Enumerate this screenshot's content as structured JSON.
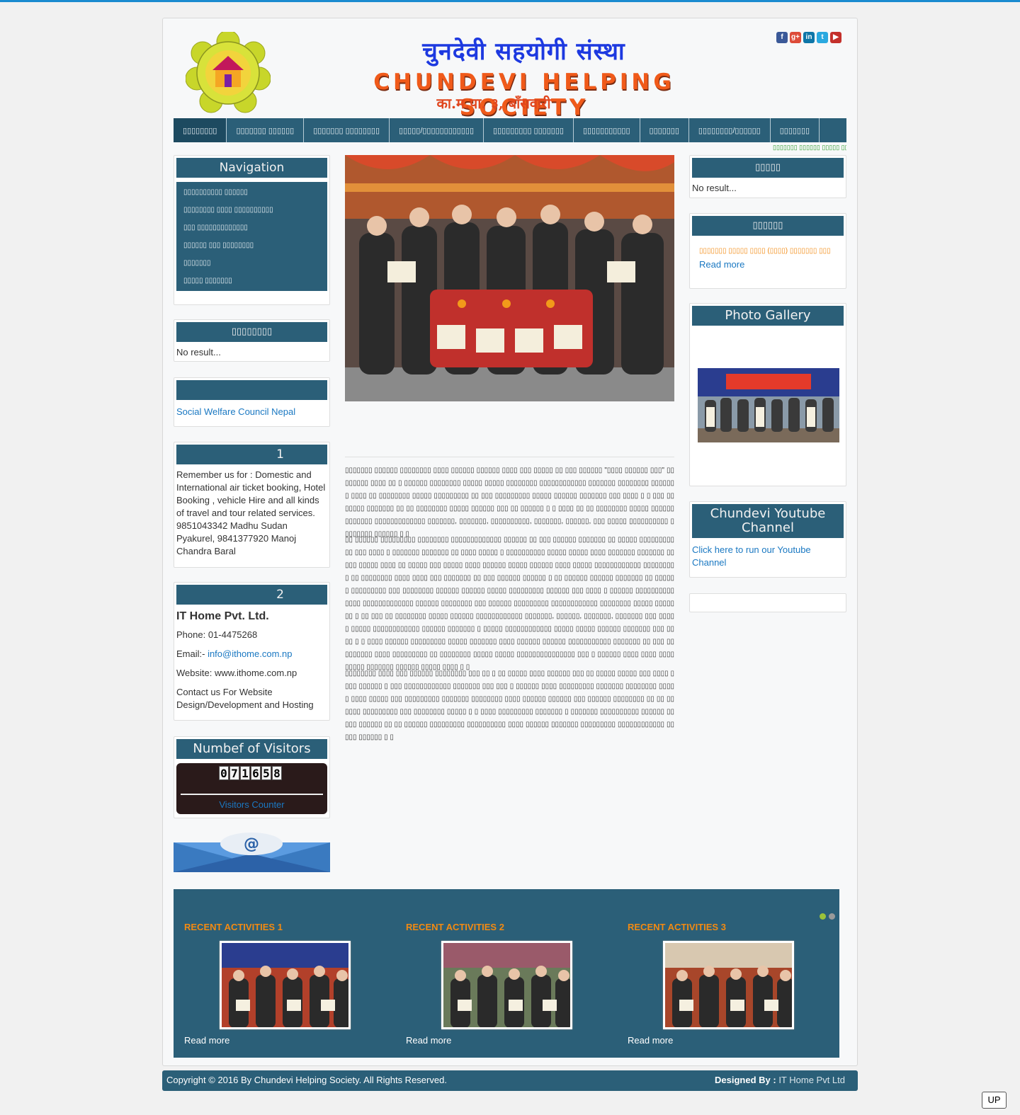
{
  "header": {
    "title_np": "चुनदेवी सहयोगी संस्था",
    "title_en": "CHUNDEVI HELPING SOCIETY",
    "address": "का.म.पा. ३, बाँसवारी",
    "socials": [
      {
        "icon": "facebook-icon",
        "glyph": "f",
        "color": "#3b5998"
      },
      {
        "icon": "google-plus-icon",
        "glyph": "g+",
        "color": "#dd4b39"
      },
      {
        "icon": "linkedin-icon",
        "glyph": "in",
        "color": "#0e76a8"
      },
      {
        "icon": "twitter-icon",
        "glyph": "t",
        "color": "#2aa9e0"
      },
      {
        "icon": "youtube-icon",
        "glyph": "▶",
        "color": "#c4302b"
      }
    ]
  },
  "menu": [
    "▯▯▯▯▯▯▯▯",
    "▯▯▯▯▯▯▯ ▯▯▯▯▯▯",
    "▯▯▯▯▯▯▯ ▯▯▯▯▯▯▯▯",
    "▯▯▯▯▯/▯▯▯▯▯▯▯▯▯▯▯▯",
    "▯▯▯▯▯▯▯▯▯ ▯▯▯▯▯▯▯",
    "▯▯▯▯▯▯▯▯▯▯▯",
    "▯▯▯▯▯▯▯",
    "▯▯▯▯▯▯▯▯/▯▯▯▯▯▯",
    "▯▯▯▯▯▯▯"
  ],
  "marquee": "▯▯▯▯▯▯▯ ▯▯▯▯▯▯ ▯▯▯▯▯ ▯▯▯",
  "left": {
    "navigation": {
      "title": "Navigation",
      "items": [
        "▯▯▯▯▯▯▯▯▯▯ ▯▯▯▯▯▯",
        "▯▯▯▯▯▯▯▯ ▯▯▯▯ ▯▯▯▯▯▯▯▯▯▯",
        "▯▯▯ ▯▯▯▯▯▯▯▯▯▯▯▯▯",
        "▯▯▯▯▯▯ ▯▯▯ ▯▯▯▯▯▯▯▯",
        "▯▯▯▯▯▯▯",
        "▯▯▯▯▯ ▯▯▯▯▯▯▯"
      ]
    },
    "box2": {
      "title": "▯▯▯▯▯▯▯▯",
      "text": "No result..."
    },
    "box3": {
      "title": "",
      "link": "Social Welfare Council Nepal"
    },
    "box4": {
      "title": "1",
      "text": "Remember us for : Domestic and International air ticket booking, Hotel Booking , vehicle Hire and all kinds of travel and tour related services. 9851043342 Madhu Sudan Pyakurel, 9841377920 Manoj Chandra Baral"
    },
    "box5": {
      "title": "2",
      "company": "IT Home Pvt. Ltd.",
      "phone": "Phone: 01-4475268",
      "email_label": "Email:- ",
      "email": "info@ithome.com.np",
      "website": "Website: www.ithome.com.np",
      "contact": "Contact us For Website Design/Development and Hosting"
    },
    "visitors": {
      "title": "Numbef of Visitors",
      "digits": [
        "0",
        "7",
        "1",
        "6",
        "5",
        "8"
      ],
      "label": "Visitors Counter"
    }
  },
  "right": {
    "box1": {
      "title": "▯▯▯▯▯",
      "text": "No result..."
    },
    "box2": {
      "title": "▯▯▯▯▯▯",
      "item": "▯▯▯▯▯▯▯ ▯▯▯▯▯ ▯▯▯▯ (▯▯▯▯) ▯▯▯▯▯▯▯ ▯▯▯",
      "more": "Read more"
    },
    "gallery": {
      "title": "Photo Gallery"
    },
    "youtube": {
      "title": "Chundevi Youtube Channel",
      "link": "Click here to run our Youtube Channel"
    }
  },
  "main": {
    "paragraphs": [
      "▯▯▯▯▯▯▯ ▯▯▯▯▯▯ ▯▯▯▯▯▯▯▯ ▯▯▯▯ ▯▯▯▯▯▯ ▯▯▯▯▯▯ ▯▯▯▯ ▯▯▯ ▯▯▯▯▯ ▯▯ ▯▯▯ ▯▯▯▯▯▯ \"▯▯▯▯ ▯▯▯▯▯▯ ▯▯▯\" ▯▯ ▯▯▯▯▯▯ ▯▯▯▯ ▯▯ ▯ ▯▯▯▯▯▯ ▯▯▯▯▯▯▯▯ ▯▯▯▯▯ ▯▯▯▯▯ ▯▯▯▯▯▯▯▯ ▯▯▯▯▯▯▯▯▯▯▯▯ ▯▯▯▯▯▯▯ ▯▯▯▯▯▯▯▯ ▯▯▯▯▯▯▯ ▯▯▯▯ ▯▯ ▯▯▯▯▯▯▯▯ ▯▯▯▯▯ ▯▯▯▯▯▯▯▯▯ ▯▯ ▯▯▯ ▯▯▯▯▯▯▯▯▯ ▯▯▯▯▯ ▯▯▯▯▯▯ ▯▯▯▯▯▯▯ ▯▯▯ ▯▯▯▯ ▯ ▯ ▯▯▯ ▯▯▯▯▯▯▯ ▯▯▯▯▯▯▯ ▯▯ ▯▯ ▯▯▯▯▯▯▯▯ ▯▯▯▯▯ ▯▯▯▯▯▯ ▯▯▯ ▯▯ ▯▯▯▯▯▯ ▯ ▯ ▯▯▯▯ ▯▯ ▯▯ ▯▯▯▯▯▯▯▯ ▯▯▯▯▯ ▯▯▯▯▯▯▯▯▯▯▯▯▯ ▯▯▯▯▯▯▯▯▯▯▯▯▯ ▯▯▯▯▯▯▯, ▯▯▯▯▯▯▯, ▯▯▯▯▯▯▯▯▯▯, ▯▯▯▯▯▯▯, ▯▯▯▯▯▯, ▯▯▯ ▯▯▯▯▯ ▯▯▯▯▯▯▯▯▯▯ ▯▯▯▯▯▯▯▯ ▯▯▯▯▯▯ ▯ ▯",
      "▯▯ ▯▯▯▯▯▯ ▯▯▯▯▯▯▯▯▯ ▯▯▯▯▯▯▯▯ ▯▯▯▯▯▯▯▯▯▯▯▯▯ ▯▯▯▯▯▯ ▯▯ ▯▯▯ ▯▯▯▯▯▯ ▯▯▯▯▯▯▯ ▯▯ ▯▯▯▯▯ ▯▯▯▯▯▯▯▯▯▯▯ ▯▯▯ ▯▯▯▯ ▯ ▯▯▯▯▯▯▯ ▯▯▯▯▯▯▯ ▯▯ ▯▯▯▯ ▯▯▯▯▯ ▯ ▯▯▯▯▯▯▯▯▯▯ ▯▯▯▯▯ ▯▯▯▯▯ ▯▯▯▯ ▯▯▯▯▯▯▯ ▯▯▯▯▯▯▯ ▯▯ ▯▯▯ ▯▯▯▯▯  ▯▯▯▯ ▯▯ ▯▯▯▯▯ ▯▯▯ ▯▯▯▯▯ ▯▯▯▯ ▯▯▯▯▯▯ ▯▯▯▯▯ ▯▯▯▯▯▯ ▯▯▯▯ ▯▯▯▯▯ ▯▯▯▯▯▯▯▯▯▯▯▯ ▯▯▯▯▯▯▯▯▯ ▯▯ ▯▯▯▯▯▯▯▯ ▯▯▯▯ ▯▯▯▯ ▯▯▯ ▯▯▯▯▯▯▯ ▯▯ ▯▯▯ ▯▯▯▯▯▯ ▯▯▯▯▯▯ ▯ ▯▯ ▯▯▯▯▯▯ ▯▯▯▯▯▯ ▯▯▯▯▯▯▯ ▯▯ ▯▯▯▯▯▯ ▯▯▯▯▯▯▯▯▯ ▯▯▯ ▯▯▯▯▯▯▯▯ ▯▯▯▯▯▯ ▯▯▯▯▯▯ ▯▯▯▯▯ ▯▯▯▯▯▯▯▯▯ ▯▯▯▯▯▯ ▯▯▯ ▯▯▯▯ ▯ ▯▯▯▯▯▯ ▯▯▯▯▯▯▯▯▯▯▯▯▯▯ ▯▯▯▯▯▯▯▯▯▯▯▯▯ ▯▯▯▯▯▯ ▯▯▯▯▯▯▯▯ ▯▯▯ ▯▯▯▯▯▯ ▯▯▯▯▯▯▯▯▯ ▯▯▯▯▯▯▯▯▯▯▯▯ ▯▯▯▯▯▯▯▯ ▯▯▯▯▯ ▯▯▯▯▯▯▯ ▯ ▯▯ ▯▯▯ ▯▯ ▯▯▯▯▯▯▯▯ ▯▯▯▯▯ ▯▯▯▯▯▯ ▯▯▯▯▯▯▯▯▯▯▯▯ ▯▯▯▯▯▯▯, ▯▯▯▯▯▯, ▯▯▯▯▯▯▯, ▯▯▯▯▯▯▯ ▯▯▯ ▯▯▯▯▯ ▯▯▯▯▯ ▯▯▯▯▯▯▯▯▯▯▯▯ ▯▯▯▯▯▯ ▯▯▯▯▯▯▯ ▯ ▯▯▯▯▯ ▯▯▯▯▯▯▯▯▯▯▯▯ ▯▯▯▯▯ ▯▯▯▯▯ ▯▯▯▯▯▯ ▯▯▯▯▯▯▯ ▯▯▯ ▯▯▯▯ ▯ ▯ ▯▯▯▯ ▯▯▯▯▯▯ ▯▯▯▯▯▯▯▯▯ ▯▯▯▯▯ ▯▯▯▯▯▯▯ ▯▯▯▯ ▯▯▯▯▯▯ ▯▯▯▯▯▯ ▯▯▯▯▯▯▯▯▯▯▯ ▯▯▯▯▯▯▯ ▯▯ ▯▯▯ ▯▯▯▯▯▯▯▯▯ ▯▯▯▯ ▯▯▯▯▯▯▯▯▯ ▯▯ ▯▯▯▯▯▯▯▯ ▯▯▯▯▯ ▯▯▯▯▯ ▯▯▯▯▯▯▯▯▯▯▯▯▯▯▯ ▯▯▯ ▯ ▯▯▯▯▯▯ ▯▯▯▯ ▯▯▯▯ ▯▯▯▯ ▯▯▯▯▯ ▯▯▯▯▯▯▯ ▯▯▯▯▯▯ ▯▯▯▯▯ ▯▯▯▯ ▯ ▯",
      "▯▯▯▯▯▯▯▯ ▯▯▯▯ ▯▯▯ ▯▯▯▯▯▯ ▯▯▯▯▯▯▯▯ ▯▯▯ ▯▯ ▯ ▯▯ ▯▯▯▯▯ ▯▯▯▯ ▯▯▯▯▯▯ ▯▯▯ ▯▯ ▯▯▯▯▯ ▯▯▯▯▯ ▯▯▯ ▯▯▯▯ ▯▯▯▯ ▯▯▯▯▯▯ ▯ ▯▯▯ ▯▯▯▯▯▯▯▯▯▯▯▯ ▯▯▯▯▯▯▯ ▯▯▯ ▯▯▯ ▯ ▯▯▯▯▯▯ ▯▯▯▯ ▯▯▯▯▯▯▯▯▯ ▯▯▯▯▯▯▯ ▯▯▯▯▯▯▯▯ ▯▯▯▯▯ ▯▯▯▯ ▯▯▯▯▯ ▯▯▯ ▯▯▯▯▯▯▯▯▯ ▯▯▯▯▯▯▯ ▯▯▯▯▯▯▯▯ ▯▯▯▯ ▯▯▯▯▯▯ ▯▯▯▯▯▯ ▯▯▯ ▯▯▯▯▯▯ ▯▯▯▯▯▯▯▯ ▯▯ ▯▯ ▯▯▯▯▯▯ ▯▯▯▯▯▯▯▯▯ ▯▯▯ ▯▯▯▯▯▯▯▯ ▯▯▯▯▯ ▯ ▯ ▯▯▯▯ ▯▯▯▯▯▯▯▯▯ ▯▯▯▯▯▯▯ ▯ ▯▯▯▯▯▯▯ ▯▯▯▯▯▯▯▯▯▯ ▯▯▯▯▯▯ ▯▯▯▯▯ ▯▯▯▯▯▯ ▯▯ ▯▯ ▯▯▯▯▯▯ ▯▯▯▯▯▯▯▯▯ ▯▯▯▯▯▯▯▯▯▯ ▯▯▯▯ ▯▯▯▯▯▯ ▯▯▯▯▯▯▯ ▯▯▯▯▯▯▯▯▯ ▯▯▯▯▯▯▯▯▯▯▯▯ ▯▯▯▯▯ ▯▯▯▯▯▯ ▯ ▯"
    ]
  },
  "recent": {
    "items": [
      {
        "title": "RECENT ACTIVITIES 1",
        "more": "Read more"
      },
      {
        "title": "RECENT ACTIVITIES 2",
        "more": "Read more"
      },
      {
        "title": "RECENT ACTIVITIES 3",
        "more": "Read more"
      }
    ]
  },
  "footer": {
    "copyright": "Copyright © 2016 By Chundevi Helping Society. All Rights Reserved.",
    "designed_label": "Designed By :",
    "designer": "IT Home Pvt Ltd"
  },
  "up_button": "UP",
  "colors": {
    "primary": "#2b5f78",
    "accent_orange": "#f28a12",
    "link": "#1a78c2"
  }
}
